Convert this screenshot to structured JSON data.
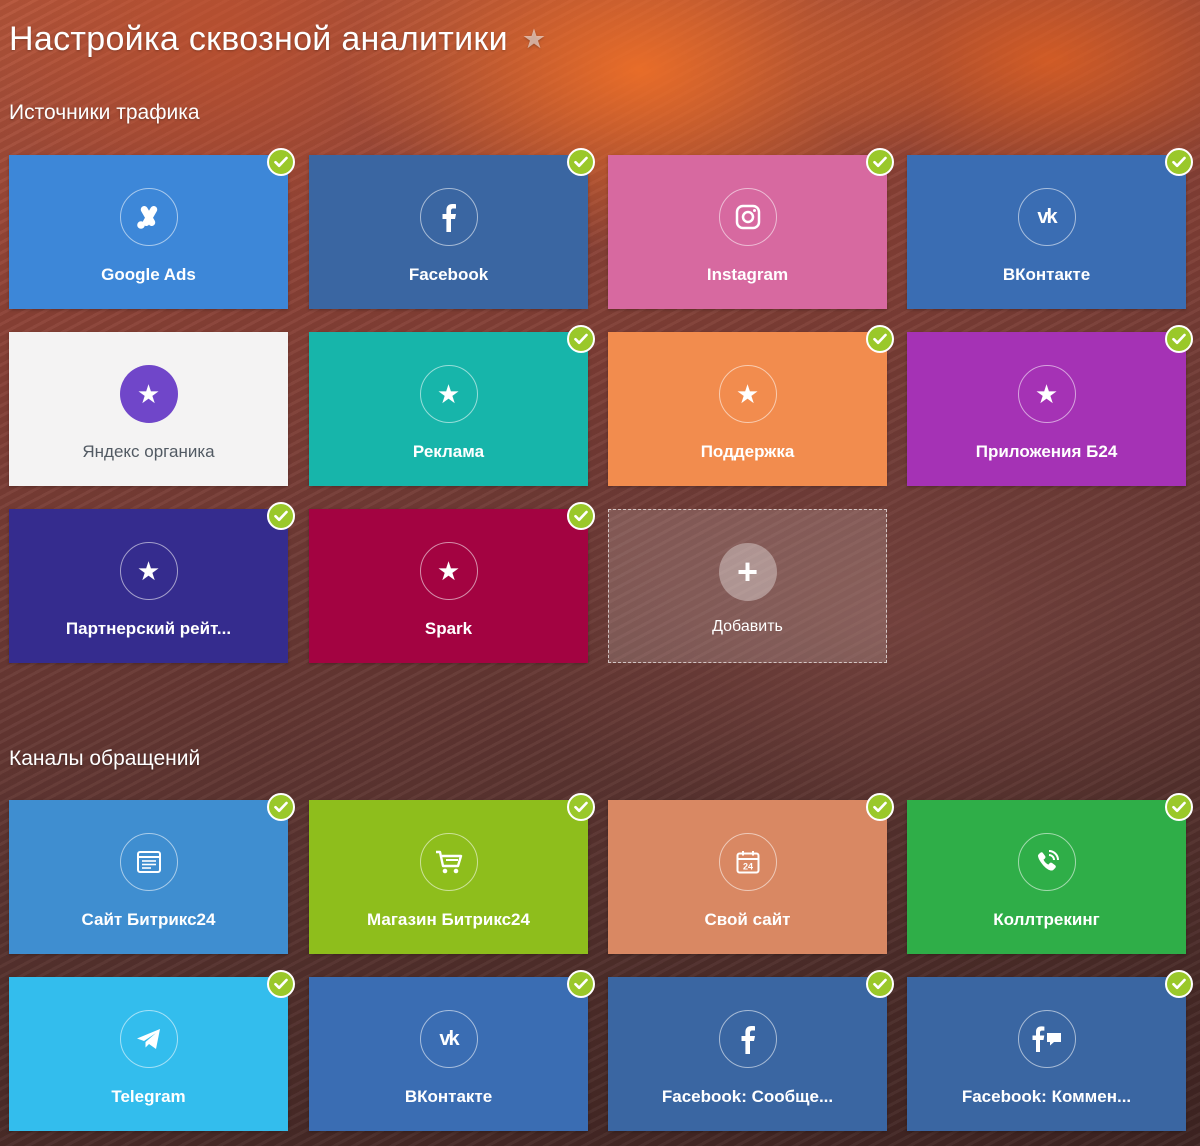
{
  "header": {
    "title": "Настройка сквозной аналитики",
    "star_icon": "star-icon"
  },
  "traffic": {
    "title": "Источники трафика",
    "tiles": [
      {
        "label": "Google Ads",
        "icon": "google-ads-icon",
        "color": "#3d87d8",
        "connected": true
      },
      {
        "label": "Facebook",
        "icon": "facebook-icon",
        "color": "#3a66a2",
        "connected": true
      },
      {
        "label": "Instagram",
        "icon": "instagram-icon",
        "color": "#d769a0",
        "connected": true
      },
      {
        "label": "ВКонтакте",
        "icon": "vk-icon",
        "color": "#3a6db3",
        "connected": true
      },
      {
        "label": "Яндекс органика",
        "icon": "star-icon",
        "color": "#f4f3f3",
        "connected": false
      },
      {
        "label": "Реклама",
        "icon": "star-icon",
        "color": "#17b5aa",
        "connected": true
      },
      {
        "label": "Поддержка",
        "icon": "star-icon",
        "color": "#f28c4e",
        "connected": true
      },
      {
        "label": "Приложения Б24",
        "icon": "star-icon",
        "color": "#a532b5",
        "connected": true
      },
      {
        "label": "Партнерский рейт...",
        "icon": "star-icon",
        "color": "#352c8e",
        "connected": true
      },
      {
        "label": "Spark",
        "icon": "star-icon",
        "color": "#a30341",
        "connected": true
      }
    ],
    "add_label": "Добавить"
  },
  "channels": {
    "title": "Каналы обращений",
    "tiles": [
      {
        "label": "Сайт Битрикс24",
        "icon": "site-icon",
        "color": "#3f8ed0",
        "connected": true
      },
      {
        "label": "Магазин Битрикс24",
        "icon": "cart-icon",
        "color": "#8ebe1c",
        "connected": true
      },
      {
        "label": "Свой сайт",
        "icon": "calendar-icon",
        "color": "#d98863",
        "connected": true
      },
      {
        "label": "Коллтрекинг",
        "icon": "phone-icon",
        "color": "#2fae48",
        "connected": true
      },
      {
        "label": "Telegram",
        "icon": "telegram-icon",
        "color": "#33bded",
        "connected": true
      },
      {
        "label": "ВКонтакте",
        "icon": "vk-icon",
        "color": "#3a6db3",
        "connected": true
      },
      {
        "label": "Facebook: Сообще...",
        "icon": "facebook-icon",
        "color": "#3a66a2",
        "connected": true
      },
      {
        "label": "Facebook: Коммен...",
        "icon": "facebook-comments-icon",
        "color": "#3a66a2",
        "connected": true
      }
    ]
  }
}
